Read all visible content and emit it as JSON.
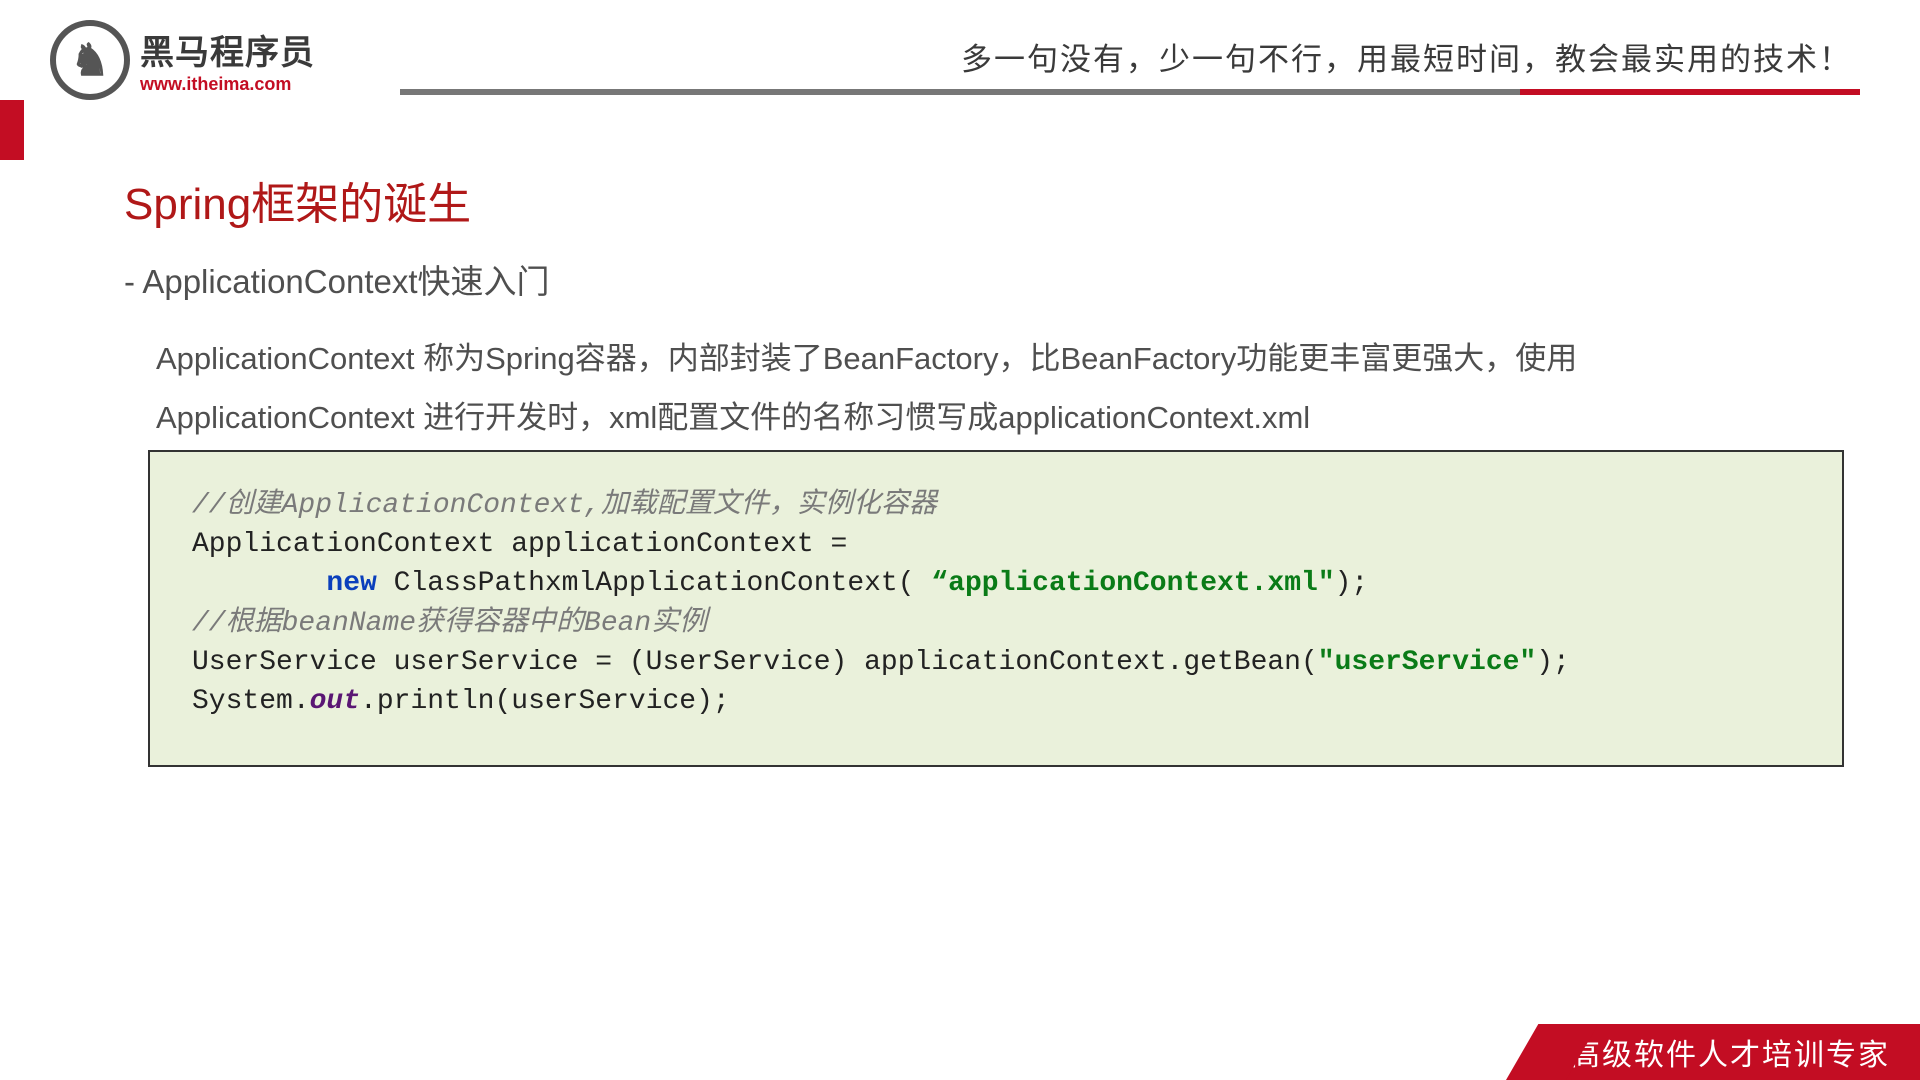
{
  "logo": {
    "glyph": "♞",
    "name": "黑马程序员",
    "url": "www.itheima.com"
  },
  "slogan": "多一句没有，少一句不行，用最短时间，教会最实用的技术！",
  "title": "Spring框架的诞生",
  "subtitle": "- ApplicationContext快速入门",
  "paragraph": "ApplicationContext 称为Spring容器，内部封装了BeanFactory，比BeanFactory功能更丰富更强大，使用ApplicationContext 进行开发时，xml配置文件的名称习惯写成applicationContext.xml",
  "code": {
    "c1": "//创建ApplicationContext,加载配置文件，实例化容器",
    "l1a": "ApplicationContext applicationContext =",
    "l2_indent": "        ",
    "kw_new": "new",
    "l2a": " ClassPathxmlApplicationContext( ",
    "l2_qopen": "“",
    "str1": "applicationContext.xml\"",
    "l2b": ");",
    "c2": "//根据beanName获得容器中的Bean实例",
    "l3a": "UserService userService = (UserService) applicationContext.getBean(",
    "str2": "\"userService\"",
    "l3b": ");",
    "l4a": "System.",
    "fld_out": "out",
    "l4b": ".println(userService);"
  },
  "footer": "高级软件人才培训专家"
}
